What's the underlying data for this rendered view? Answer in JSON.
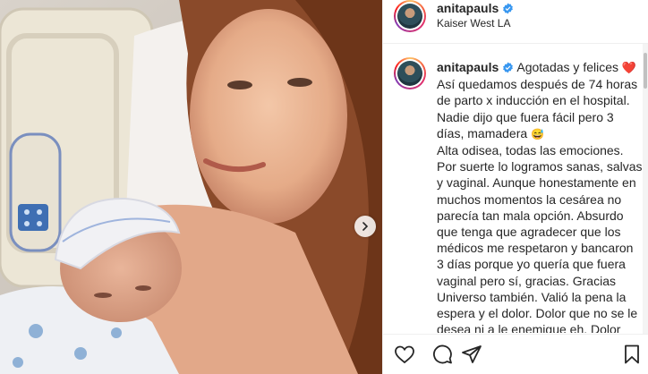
{
  "header": {
    "username": "anitapauls",
    "location": "Kaiser West LA"
  },
  "caption": {
    "username": "anitapauls",
    "lead": "Agotadas y felices",
    "lead_emoji": "❤️",
    "text": "Así quedamos después de 74 horas de parto x inducción en el hospital. Nadie dijo que fuera fácil pero 3 días, mamadera",
    "text_emoji": "😅",
    "body": "Alta odisea, todas las emociones. Por suerte lo logramos sanas, salvas y vaginal. Aunque honestamente en muchos momentos la cesárea no parecía tan mala opción. Absurdo que tenga que agradecer que los médicos me respetaron y bancaron 3 días porque yo quería que fuera vaginal pero sí, gracias. Gracias Universo también. Valió la pena la espera y el dolor. Dolor que no se le desea ni a le enemigue eh. Dolor incomparable nunca antes sentido. Entendí qué hay algo que es vomitar del dolor. Qué? El"
  },
  "colors": {
    "verified": "#3897f0",
    "heart": "#ed1c4e",
    "border": "#efefef",
    "text": "#262626"
  },
  "icons": {
    "like": "heart-outline-icon",
    "comment": "comment-icon",
    "share": "paper-plane-icon",
    "save": "bookmark-icon",
    "carousel": "chevron-right-icon",
    "verified": "verified-badge-icon"
  }
}
